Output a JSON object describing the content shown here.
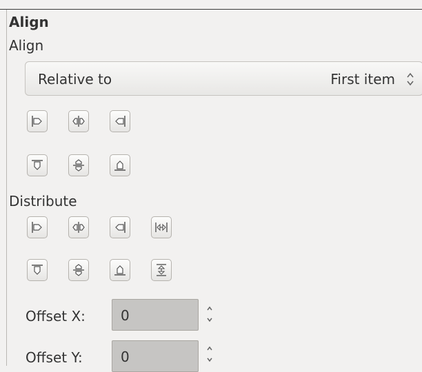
{
  "panel": {
    "title": "Align",
    "align_label": "Align",
    "distribute_label": "Distribute"
  },
  "relative_to": {
    "label": "Relative to",
    "value": "First item"
  },
  "align_buttons": {
    "row1": [
      "align-left-edges-icon",
      "center-horizontally-icon",
      "align-right-edges-icon"
    ],
    "row2": [
      "align-top-edges-icon",
      "center-vertically-icon",
      "align-bottom-edges-icon"
    ]
  },
  "distribute_buttons": {
    "row1": [
      "distribute-left-edges-icon",
      "distribute-centers-horizontally-icon",
      "distribute-right-edges-icon",
      "distribute-horizontal-gaps-icon"
    ],
    "row2": [
      "distribute-top-edges-icon",
      "distribute-centers-vertically-icon",
      "distribute-bottom-edges-icon",
      "distribute-vertical-gaps-icon"
    ]
  },
  "offset": {
    "x_label": "Offset X:",
    "x_value": "0",
    "y_label": "Offset Y:",
    "y_value": "0"
  }
}
